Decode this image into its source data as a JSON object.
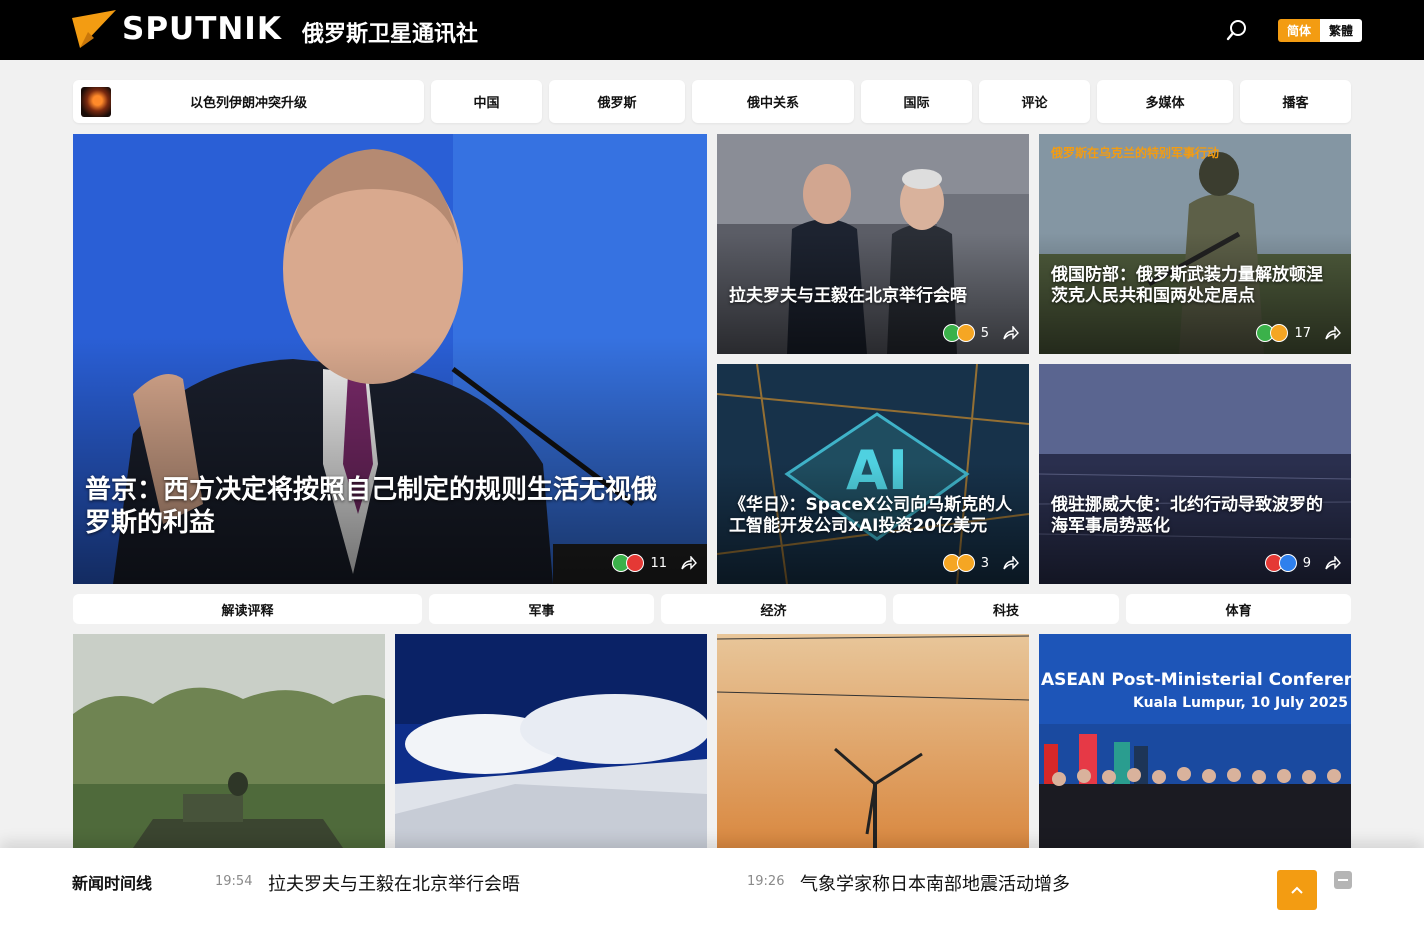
{
  "header": {
    "logo_word": "SPUTNIK",
    "logo_cn": "俄罗斯卫星通讯社",
    "search_icon": "search-icon",
    "lang": {
      "simplified": "简体",
      "traditional": "繁體"
    },
    "accent_color": "#f39c12"
  },
  "nav": {
    "items": [
      {
        "label": "以色列伊朗冲突升级"
      },
      {
        "label": "中国"
      },
      {
        "label": "俄罗斯"
      },
      {
        "label": "俄中关系"
      },
      {
        "label": "国际"
      },
      {
        "label": "评论"
      },
      {
        "label": "多媒体"
      },
      {
        "label": "播客"
      }
    ]
  },
  "featured": {
    "main": {
      "title": "普京：西方决定将按照自己制定的规则生活无视俄罗斯的利益",
      "reaction_count": "11",
      "reactions": [
        "like-icon",
        "angry-icon"
      ]
    },
    "card1": {
      "title": "拉夫罗夫与王毅在北京举行会晤",
      "reaction_count": "5",
      "reactions": [
        "like-icon",
        "smile-icon"
      ]
    },
    "card2": {
      "tag": "俄罗斯在乌克兰的特别军事行动",
      "title": "俄国防部：俄罗斯武装力量解放顿涅茨克人民共和国两处定居点",
      "reaction_count": "17",
      "reactions": [
        "like-icon",
        "smile-icon"
      ]
    },
    "card3": {
      "title": "《华日》：SpaceX公司向马斯克的人工智能开发公司xAI投资20亿美元",
      "reaction_count": "3",
      "reactions": [
        "smile-icon",
        "wow-icon"
      ]
    },
    "card4": {
      "title": "俄驻挪威大使：北约行动导致波罗的海军事局势恶化",
      "reaction_count": "9",
      "reactions": [
        "angry-icon",
        "sad-icon"
      ]
    }
  },
  "subnav": {
    "items": [
      {
        "label": "解读评释"
      },
      {
        "label": "军事"
      },
      {
        "label": "经济"
      },
      {
        "label": "科技"
      },
      {
        "label": "体育"
      }
    ]
  },
  "bottom_cards": {
    "asean_line1": "ASEAN Post-Ministerial Conference wi",
    "asean_line2": "Kuala Lumpur, 10 July 2025"
  },
  "timeline": {
    "label": "新闻时间线",
    "items": [
      {
        "time": "19:54",
        "text": "拉夫罗夫与王毅在北京举行会晤"
      },
      {
        "time": "19:26",
        "text": "气象学家称日本南部地震活动增多"
      }
    ]
  }
}
